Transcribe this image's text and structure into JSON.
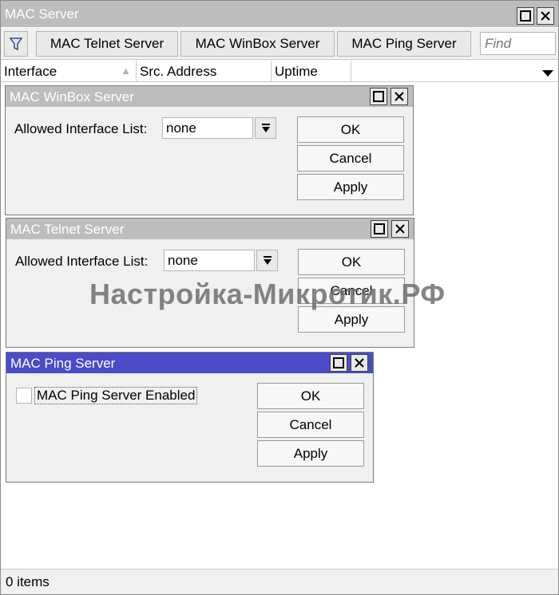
{
  "window": {
    "title": "MAC Server"
  },
  "toolbar": {
    "filter_icon": "filter-icon",
    "tabs": [
      "MAC Telnet Server",
      "MAC WinBox Server",
      "MAC Ping Server"
    ],
    "find_placeholder": "Find"
  },
  "table": {
    "columns": [
      "Interface",
      "Src. Address",
      "Uptime"
    ],
    "sort_indicator": "▲"
  },
  "status": {
    "items_text": "0 items"
  },
  "winbox_dialog": {
    "title": "MAC WinBox Server",
    "field_label": "Allowed Interface List:",
    "field_value": "none",
    "buttons": {
      "ok": "OK",
      "cancel": "Cancel",
      "apply": "Apply"
    }
  },
  "telnet_dialog": {
    "title": "MAC Telnet Server",
    "field_label": "Allowed Interface List:",
    "field_value": "none",
    "buttons": {
      "ok": "OK",
      "cancel": "Cancel",
      "apply": "Apply"
    }
  },
  "ping_dialog": {
    "title": "MAC Ping Server",
    "checkbox_label": "MAC Ping Server Enabled",
    "checkbox_checked": false,
    "buttons": {
      "ok": "OK",
      "cancel": "Cancel",
      "apply": "Apply"
    }
  },
  "watermark": "Настройка-Микротик.РФ",
  "colors": {
    "active_title": "#4b4bc8",
    "inactive_title": "#bdbdbd"
  }
}
